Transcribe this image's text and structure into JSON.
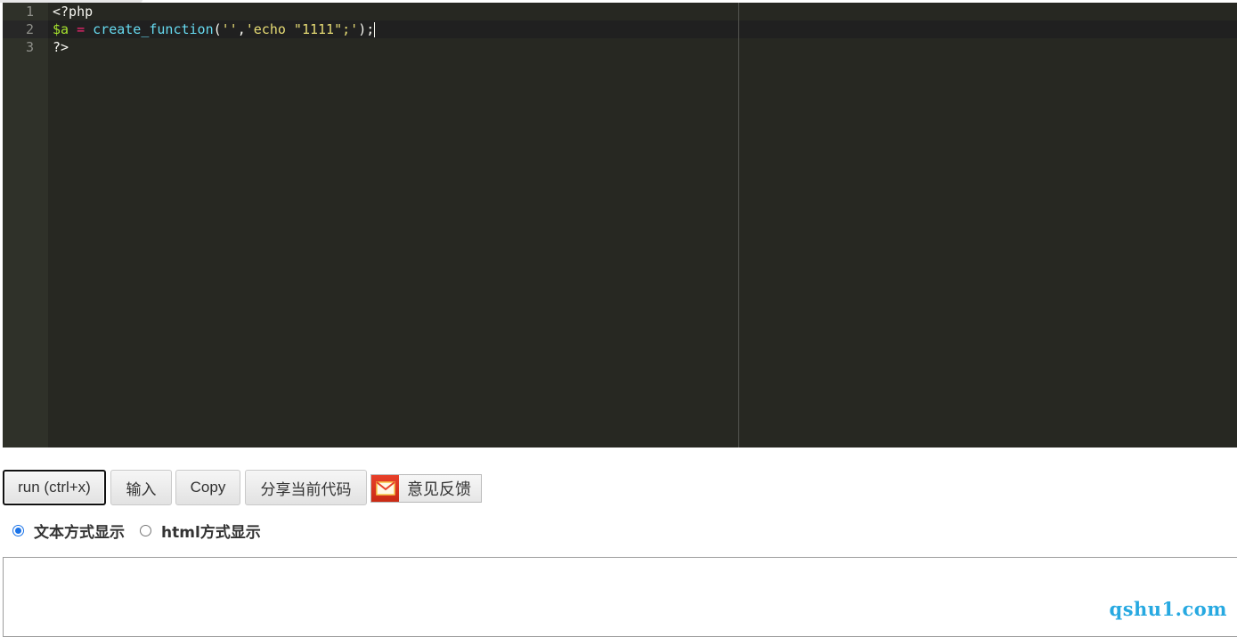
{
  "editor": {
    "line_numbers": [
      "1",
      "2",
      "3"
    ],
    "code": {
      "line1": "<?php",
      "line2_var": "$a",
      "line2_eq": " = ",
      "line2_fn": "create_function",
      "line2_open": "(",
      "line2_arg1": "''",
      "line2_comma": ",",
      "line2_arg2": "'echo \"1111\";'",
      "line2_close": ");",
      "line3": "?>"
    }
  },
  "toolbar": {
    "run_label": "run (ctrl+x)",
    "input_label": "输入",
    "copy_label": "Copy",
    "share_label": "分享当前代码",
    "feedback_label": "意见反馈"
  },
  "display_options": {
    "text_mode_label": "文本方式显示",
    "html_mode_label": "html方式显示",
    "selected": "text"
  },
  "watermark": "qshu1.com",
  "colors": {
    "editor_bg": "#272822",
    "accent": "#1a73e8",
    "watermark": "#27a9e1"
  }
}
